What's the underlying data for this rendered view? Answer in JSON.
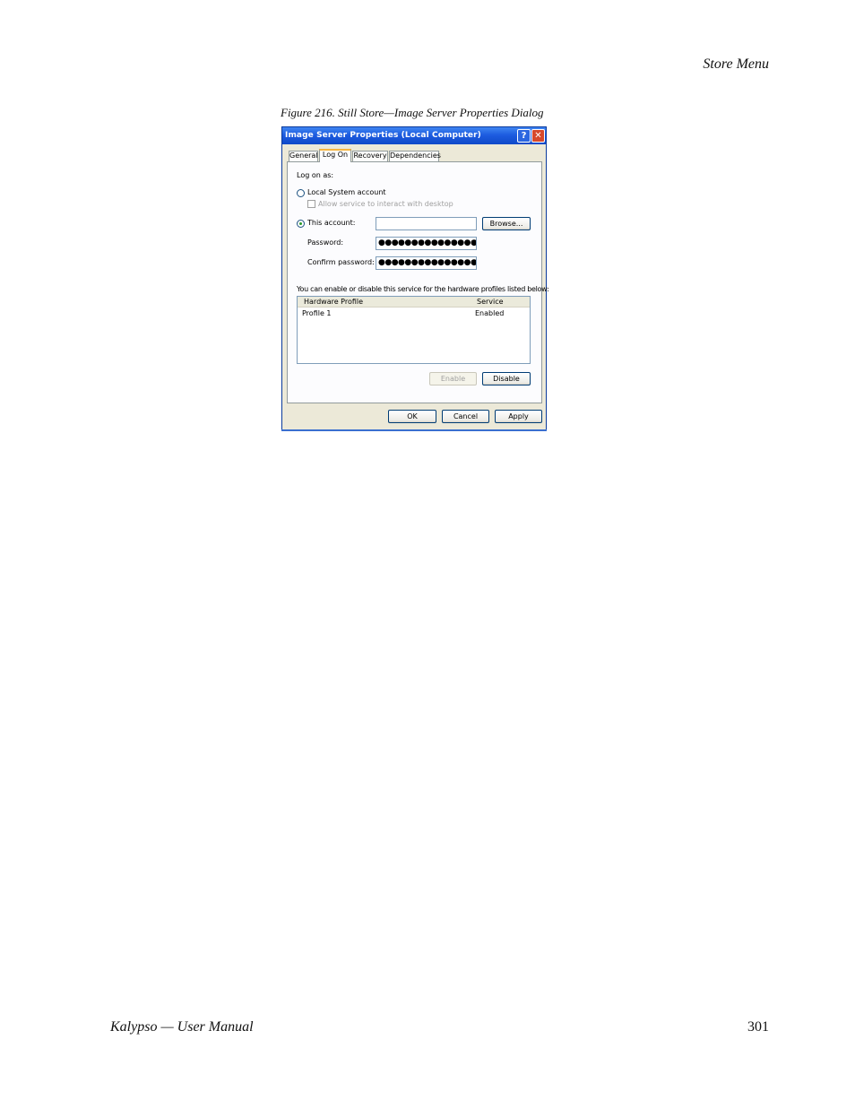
{
  "page": {
    "section_header": "Store Menu",
    "figure_caption": "Figure 216.  Still Store—Image Server Properties Dialog",
    "footer_left": "Kalypso — User Manual",
    "footer_right": "301"
  },
  "dialog": {
    "title": "Image Server Properties (Local Computer)",
    "help_glyph": "?",
    "close_glyph": "✕",
    "tabs": [
      "General",
      "Log On",
      "Recovery",
      "Dependencies"
    ],
    "active_tab": "Log On",
    "logon_as_label": "Log on as:",
    "local_system_label": "Local System account",
    "allow_interact_label": "Allow service to interact with desktop",
    "this_account_label": "This account:",
    "this_account_value": "",
    "browse_label": "Browse...",
    "password_label": "Password:",
    "password_value": "●●●●●●●●●●●●●●●",
    "confirm_label": "Confirm password:",
    "confirm_value": "●●●●●●●●●●●●●●●",
    "profiles_note": "You can enable or disable this service for the hardware profiles listed below:",
    "columns": [
      "Hardware Profile",
      "Service"
    ],
    "rows": [
      {
        "profile": "Profile 1",
        "service": "Enabled"
      }
    ],
    "enable_label": "Enable",
    "disable_label": "Disable",
    "ok_label": "OK",
    "cancel_label": "Cancel",
    "apply_label": "Apply",
    "selected_logon": "This account",
    "title_bar_color": "#1d5ce0"
  }
}
